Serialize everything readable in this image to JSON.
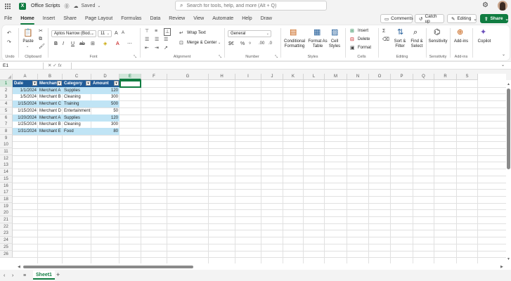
{
  "titlebar": {
    "doc_title": "Office Scripts",
    "saved": "Saved",
    "search_placeholder": "Search for tools, help, and more (Alt + Q)"
  },
  "tabs": [
    "File",
    "Home",
    "Insert",
    "Share",
    "Page Layout",
    "Formulas",
    "Data",
    "Review",
    "View",
    "Automate",
    "Help",
    "Draw"
  ],
  "right_buttons": {
    "comments": "Comments",
    "catchup": "Catch up",
    "editing": "Editing",
    "share": "Share"
  },
  "ribbon": {
    "undo_label": "Undo",
    "clipboard_label": "Clipboard",
    "paste": "Paste",
    "font_name": "Aptos Narrow (Bod...",
    "font_size": "11",
    "font_label": "Font",
    "wrap_text": "Wrap Text",
    "merge_center": "Merge & Center",
    "alignment_label": "Alignment",
    "number_format": "General",
    "number_label": "Number",
    "conditional_formatting": "Conditional Formatting",
    "format_as_table": "Format As Table",
    "cell_styles": "Cell Styles",
    "styles_label": "Styles",
    "insert": "Insert",
    "delete": "Delete",
    "format": "Format",
    "cells_label": "Cells",
    "sort_filter": "Sort & Filter",
    "find_select": "Find & Select",
    "editing_label": "Editing",
    "sensitivity": "Sensitivity",
    "sensitivity_label": "Sensitivity",
    "addins": "Add-ins",
    "addins_label": "Add-ins",
    "copilot": "Copilot"
  },
  "formula_bar": {
    "name_box": "E1",
    "fx": "fx",
    "formula": ""
  },
  "columns": [
    "A",
    "B",
    "C",
    "D",
    "E",
    "F",
    "G",
    "H",
    "I",
    "J",
    "K",
    "L",
    "M",
    "N",
    "O",
    "P",
    "Q",
    "R",
    "S"
  ],
  "selected_column": "E",
  "rows": [
    "1",
    "2",
    "3",
    "4",
    "5",
    "6",
    "7",
    "8",
    "9",
    "10",
    "11",
    "12",
    "13",
    "14",
    "15",
    "16",
    "17",
    "18",
    "19",
    "20",
    "21",
    "22",
    "23",
    "24",
    "25",
    "26"
  ],
  "table": {
    "headers": [
      "Date",
      "Merchant",
      "Category",
      "Amount"
    ],
    "rows": [
      [
        "1/1/2024",
        "Merchant A",
        "Supplies",
        "120"
      ],
      [
        "1/5/2024",
        "Merchant B",
        "Cleaning",
        "300"
      ],
      [
        "1/15/2024",
        "Merchant C",
        "Training",
        "500"
      ],
      [
        "1/15/2024",
        "Merchant D",
        "Entertainment",
        "50"
      ],
      [
        "1/20/2024",
        "Merchant A",
        "Supplies",
        "120"
      ],
      [
        "1/25/2024",
        "Merchant B",
        "Cleaning",
        "300"
      ],
      [
        "1/31/2024",
        "Merchant E",
        "Food",
        "80"
      ]
    ]
  },
  "sheet_tab": "Sheet1",
  "colors": {
    "accent": "#107c41",
    "table_header": "#215c98",
    "table_band": "#c0e4f5"
  }
}
